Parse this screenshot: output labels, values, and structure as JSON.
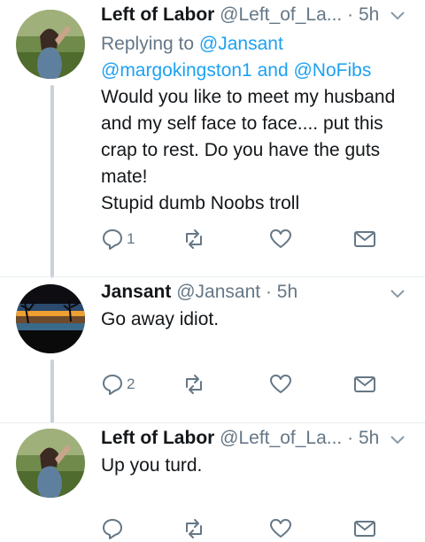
{
  "tweets": [
    {
      "name": "Left of Labor",
      "handle": "@Left_of_La...",
      "dot": "·",
      "time": "5h",
      "reply_label": "Replying to",
      "mentions": [
        "@Jansant",
        "@margokingston1",
        "@NoFibs"
      ],
      "and_text": "and",
      "lines": [
        "Would you like to meet my husband",
        "and my self face to face.... put this",
        "crap to rest. Do you have the guts",
        "mate!",
        "Stupid dumb Noobs troll"
      ],
      "reply_count": "1",
      "avatar": "woman-outdoor-photo"
    },
    {
      "name": "Jansant",
      "handle": "@Jansant",
      "dot": "·",
      "time": "5h",
      "lines": [
        "Go away idiot."
      ],
      "reply_count": "2",
      "avatar": "sunset-lake-photo"
    },
    {
      "name": "Left of Labor",
      "handle": "@Left_of_La...",
      "dot": "·",
      "time": "5h",
      "lines": [
        "Up you turd."
      ],
      "reply_count": "",
      "avatar": "woman-outdoor-photo"
    }
  ],
  "icons": {
    "reply": "reply-icon",
    "retweet": "retweet-icon",
    "like": "heart-icon",
    "dm": "envelope-icon",
    "caret": "chevron-down-icon"
  },
  "colors": {
    "link": "#1da1f2",
    "secondary": "#657786",
    "thread": "#c9d1d8"
  }
}
